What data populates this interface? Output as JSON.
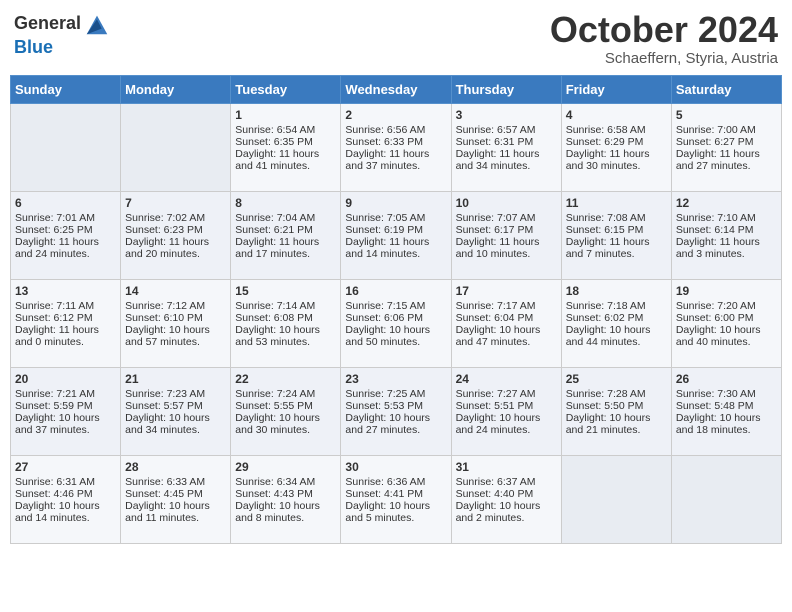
{
  "logo": {
    "line1": "General",
    "line2": "Blue"
  },
  "title": "October 2024",
  "subtitle": "Schaeffern, Styria, Austria",
  "days_of_week": [
    "Sunday",
    "Monday",
    "Tuesday",
    "Wednesday",
    "Thursday",
    "Friday",
    "Saturday"
  ],
  "weeks": [
    [
      {
        "day": "",
        "sunrise": "",
        "sunset": "",
        "daylight": ""
      },
      {
        "day": "",
        "sunrise": "",
        "sunset": "",
        "daylight": ""
      },
      {
        "day": "1",
        "sunrise": "Sunrise: 6:54 AM",
        "sunset": "Sunset: 6:35 PM",
        "daylight": "Daylight: 11 hours and 41 minutes."
      },
      {
        "day": "2",
        "sunrise": "Sunrise: 6:56 AM",
        "sunset": "Sunset: 6:33 PM",
        "daylight": "Daylight: 11 hours and 37 minutes."
      },
      {
        "day": "3",
        "sunrise": "Sunrise: 6:57 AM",
        "sunset": "Sunset: 6:31 PM",
        "daylight": "Daylight: 11 hours and 34 minutes."
      },
      {
        "day": "4",
        "sunrise": "Sunrise: 6:58 AM",
        "sunset": "Sunset: 6:29 PM",
        "daylight": "Daylight: 11 hours and 30 minutes."
      },
      {
        "day": "5",
        "sunrise": "Sunrise: 7:00 AM",
        "sunset": "Sunset: 6:27 PM",
        "daylight": "Daylight: 11 hours and 27 minutes."
      }
    ],
    [
      {
        "day": "6",
        "sunrise": "Sunrise: 7:01 AM",
        "sunset": "Sunset: 6:25 PM",
        "daylight": "Daylight: 11 hours and 24 minutes."
      },
      {
        "day": "7",
        "sunrise": "Sunrise: 7:02 AM",
        "sunset": "Sunset: 6:23 PM",
        "daylight": "Daylight: 11 hours and 20 minutes."
      },
      {
        "day": "8",
        "sunrise": "Sunrise: 7:04 AM",
        "sunset": "Sunset: 6:21 PM",
        "daylight": "Daylight: 11 hours and 17 minutes."
      },
      {
        "day": "9",
        "sunrise": "Sunrise: 7:05 AM",
        "sunset": "Sunset: 6:19 PM",
        "daylight": "Daylight: 11 hours and 14 minutes."
      },
      {
        "day": "10",
        "sunrise": "Sunrise: 7:07 AM",
        "sunset": "Sunset: 6:17 PM",
        "daylight": "Daylight: 11 hours and 10 minutes."
      },
      {
        "day": "11",
        "sunrise": "Sunrise: 7:08 AM",
        "sunset": "Sunset: 6:15 PM",
        "daylight": "Daylight: 11 hours and 7 minutes."
      },
      {
        "day": "12",
        "sunrise": "Sunrise: 7:10 AM",
        "sunset": "Sunset: 6:14 PM",
        "daylight": "Daylight: 11 hours and 3 minutes."
      }
    ],
    [
      {
        "day": "13",
        "sunrise": "Sunrise: 7:11 AM",
        "sunset": "Sunset: 6:12 PM",
        "daylight": "Daylight: 11 hours and 0 minutes."
      },
      {
        "day": "14",
        "sunrise": "Sunrise: 7:12 AM",
        "sunset": "Sunset: 6:10 PM",
        "daylight": "Daylight: 10 hours and 57 minutes."
      },
      {
        "day": "15",
        "sunrise": "Sunrise: 7:14 AM",
        "sunset": "Sunset: 6:08 PM",
        "daylight": "Daylight: 10 hours and 53 minutes."
      },
      {
        "day": "16",
        "sunrise": "Sunrise: 7:15 AM",
        "sunset": "Sunset: 6:06 PM",
        "daylight": "Daylight: 10 hours and 50 minutes."
      },
      {
        "day": "17",
        "sunrise": "Sunrise: 7:17 AM",
        "sunset": "Sunset: 6:04 PM",
        "daylight": "Daylight: 10 hours and 47 minutes."
      },
      {
        "day": "18",
        "sunrise": "Sunrise: 7:18 AM",
        "sunset": "Sunset: 6:02 PM",
        "daylight": "Daylight: 10 hours and 44 minutes."
      },
      {
        "day": "19",
        "sunrise": "Sunrise: 7:20 AM",
        "sunset": "Sunset: 6:00 PM",
        "daylight": "Daylight: 10 hours and 40 minutes."
      }
    ],
    [
      {
        "day": "20",
        "sunrise": "Sunrise: 7:21 AM",
        "sunset": "Sunset: 5:59 PM",
        "daylight": "Daylight: 10 hours and 37 minutes."
      },
      {
        "day": "21",
        "sunrise": "Sunrise: 7:23 AM",
        "sunset": "Sunset: 5:57 PM",
        "daylight": "Daylight: 10 hours and 34 minutes."
      },
      {
        "day": "22",
        "sunrise": "Sunrise: 7:24 AM",
        "sunset": "Sunset: 5:55 PM",
        "daylight": "Daylight: 10 hours and 30 minutes."
      },
      {
        "day": "23",
        "sunrise": "Sunrise: 7:25 AM",
        "sunset": "Sunset: 5:53 PM",
        "daylight": "Daylight: 10 hours and 27 minutes."
      },
      {
        "day": "24",
        "sunrise": "Sunrise: 7:27 AM",
        "sunset": "Sunset: 5:51 PM",
        "daylight": "Daylight: 10 hours and 24 minutes."
      },
      {
        "day": "25",
        "sunrise": "Sunrise: 7:28 AM",
        "sunset": "Sunset: 5:50 PM",
        "daylight": "Daylight: 10 hours and 21 minutes."
      },
      {
        "day": "26",
        "sunrise": "Sunrise: 7:30 AM",
        "sunset": "Sunset: 5:48 PM",
        "daylight": "Daylight: 10 hours and 18 minutes."
      }
    ],
    [
      {
        "day": "27",
        "sunrise": "Sunrise: 6:31 AM",
        "sunset": "Sunset: 4:46 PM",
        "daylight": "Daylight: 10 hours and 14 minutes."
      },
      {
        "day": "28",
        "sunrise": "Sunrise: 6:33 AM",
        "sunset": "Sunset: 4:45 PM",
        "daylight": "Daylight: 10 hours and 11 minutes."
      },
      {
        "day": "29",
        "sunrise": "Sunrise: 6:34 AM",
        "sunset": "Sunset: 4:43 PM",
        "daylight": "Daylight: 10 hours and 8 minutes."
      },
      {
        "day": "30",
        "sunrise": "Sunrise: 6:36 AM",
        "sunset": "Sunset: 4:41 PM",
        "daylight": "Daylight: 10 hours and 5 minutes."
      },
      {
        "day": "31",
        "sunrise": "Sunrise: 6:37 AM",
        "sunset": "Sunset: 4:40 PM",
        "daylight": "Daylight: 10 hours and 2 minutes."
      },
      {
        "day": "",
        "sunrise": "",
        "sunset": "",
        "daylight": ""
      },
      {
        "day": "",
        "sunrise": "",
        "sunset": "",
        "daylight": ""
      }
    ]
  ]
}
